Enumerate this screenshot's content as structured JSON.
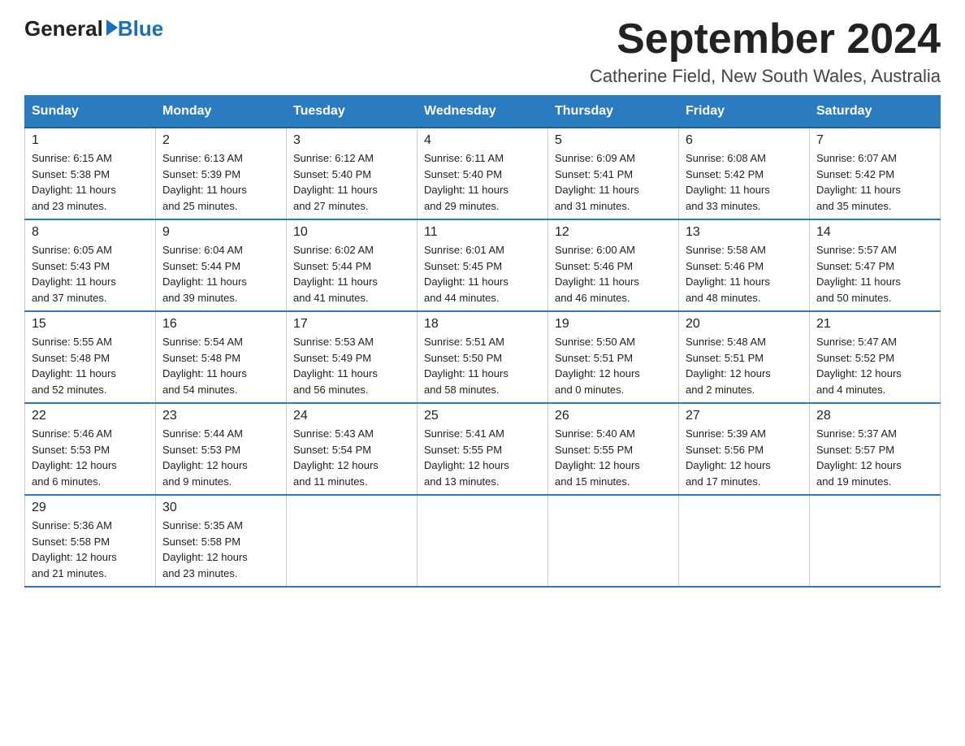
{
  "logo": {
    "general_text": "General",
    "blue_text": "Blue"
  },
  "title": {
    "month_year": "September 2024",
    "location": "Catherine Field, New South Wales, Australia"
  },
  "days_of_week": [
    "Sunday",
    "Monday",
    "Tuesday",
    "Wednesday",
    "Thursday",
    "Friday",
    "Saturday"
  ],
  "weeks": [
    [
      {
        "day": "1",
        "sunrise": "6:15 AM",
        "sunset": "5:38 PM",
        "daylight_hours": "11",
        "daylight_minutes": "23"
      },
      {
        "day": "2",
        "sunrise": "6:13 AM",
        "sunset": "5:39 PM",
        "daylight_hours": "11",
        "daylight_minutes": "25"
      },
      {
        "day": "3",
        "sunrise": "6:12 AM",
        "sunset": "5:40 PM",
        "daylight_hours": "11",
        "daylight_minutes": "27"
      },
      {
        "day": "4",
        "sunrise": "6:11 AM",
        "sunset": "5:40 PM",
        "daylight_hours": "11",
        "daylight_minutes": "29"
      },
      {
        "day": "5",
        "sunrise": "6:09 AM",
        "sunset": "5:41 PM",
        "daylight_hours": "11",
        "daylight_minutes": "31"
      },
      {
        "day": "6",
        "sunrise": "6:08 AM",
        "sunset": "5:42 PM",
        "daylight_hours": "11",
        "daylight_minutes": "33"
      },
      {
        "day": "7",
        "sunrise": "6:07 AM",
        "sunset": "5:42 PM",
        "daylight_hours": "11",
        "daylight_minutes": "35"
      }
    ],
    [
      {
        "day": "8",
        "sunrise": "6:05 AM",
        "sunset": "5:43 PM",
        "daylight_hours": "11",
        "daylight_minutes": "37"
      },
      {
        "day": "9",
        "sunrise": "6:04 AM",
        "sunset": "5:44 PM",
        "daylight_hours": "11",
        "daylight_minutes": "39"
      },
      {
        "day": "10",
        "sunrise": "6:02 AM",
        "sunset": "5:44 PM",
        "daylight_hours": "11",
        "daylight_minutes": "41"
      },
      {
        "day": "11",
        "sunrise": "6:01 AM",
        "sunset": "5:45 PM",
        "daylight_hours": "11",
        "daylight_minutes": "44"
      },
      {
        "day": "12",
        "sunrise": "6:00 AM",
        "sunset": "5:46 PM",
        "daylight_hours": "11",
        "daylight_minutes": "46"
      },
      {
        "day": "13",
        "sunrise": "5:58 AM",
        "sunset": "5:46 PM",
        "daylight_hours": "11",
        "daylight_minutes": "48"
      },
      {
        "day": "14",
        "sunrise": "5:57 AM",
        "sunset": "5:47 PM",
        "daylight_hours": "11",
        "daylight_minutes": "50"
      }
    ],
    [
      {
        "day": "15",
        "sunrise": "5:55 AM",
        "sunset": "5:48 PM",
        "daylight_hours": "11",
        "daylight_minutes": "52"
      },
      {
        "day": "16",
        "sunrise": "5:54 AM",
        "sunset": "5:48 PM",
        "daylight_hours": "11",
        "daylight_minutes": "54"
      },
      {
        "day": "17",
        "sunrise": "5:53 AM",
        "sunset": "5:49 PM",
        "daylight_hours": "11",
        "daylight_minutes": "56"
      },
      {
        "day": "18",
        "sunrise": "5:51 AM",
        "sunset": "5:50 PM",
        "daylight_hours": "11",
        "daylight_minutes": "58"
      },
      {
        "day": "19",
        "sunrise": "5:50 AM",
        "sunset": "5:51 PM",
        "daylight_hours": "12",
        "daylight_minutes": "0"
      },
      {
        "day": "20",
        "sunrise": "5:48 AM",
        "sunset": "5:51 PM",
        "daylight_hours": "12",
        "daylight_minutes": "2"
      },
      {
        "day": "21",
        "sunrise": "5:47 AM",
        "sunset": "5:52 PM",
        "daylight_hours": "12",
        "daylight_minutes": "4"
      }
    ],
    [
      {
        "day": "22",
        "sunrise": "5:46 AM",
        "sunset": "5:53 PM",
        "daylight_hours": "12",
        "daylight_minutes": "6"
      },
      {
        "day": "23",
        "sunrise": "5:44 AM",
        "sunset": "5:53 PM",
        "daylight_hours": "12",
        "daylight_minutes": "9"
      },
      {
        "day": "24",
        "sunrise": "5:43 AM",
        "sunset": "5:54 PM",
        "daylight_hours": "12",
        "daylight_minutes": "11"
      },
      {
        "day": "25",
        "sunrise": "5:41 AM",
        "sunset": "5:55 PM",
        "daylight_hours": "12",
        "daylight_minutes": "13"
      },
      {
        "day": "26",
        "sunrise": "5:40 AM",
        "sunset": "5:55 PM",
        "daylight_hours": "12",
        "daylight_minutes": "15"
      },
      {
        "day": "27",
        "sunrise": "5:39 AM",
        "sunset": "5:56 PM",
        "daylight_hours": "12",
        "daylight_minutes": "17"
      },
      {
        "day": "28",
        "sunrise": "5:37 AM",
        "sunset": "5:57 PM",
        "daylight_hours": "12",
        "daylight_minutes": "19"
      }
    ],
    [
      {
        "day": "29",
        "sunrise": "5:36 AM",
        "sunset": "5:58 PM",
        "daylight_hours": "12",
        "daylight_minutes": "21"
      },
      {
        "day": "30",
        "sunrise": "5:35 AM",
        "sunset": "5:58 PM",
        "daylight_hours": "12",
        "daylight_minutes": "23"
      },
      null,
      null,
      null,
      null,
      null
    ]
  ],
  "labels": {
    "sunrise": "Sunrise:",
    "sunset": "Sunset:",
    "daylight": "Daylight:"
  }
}
